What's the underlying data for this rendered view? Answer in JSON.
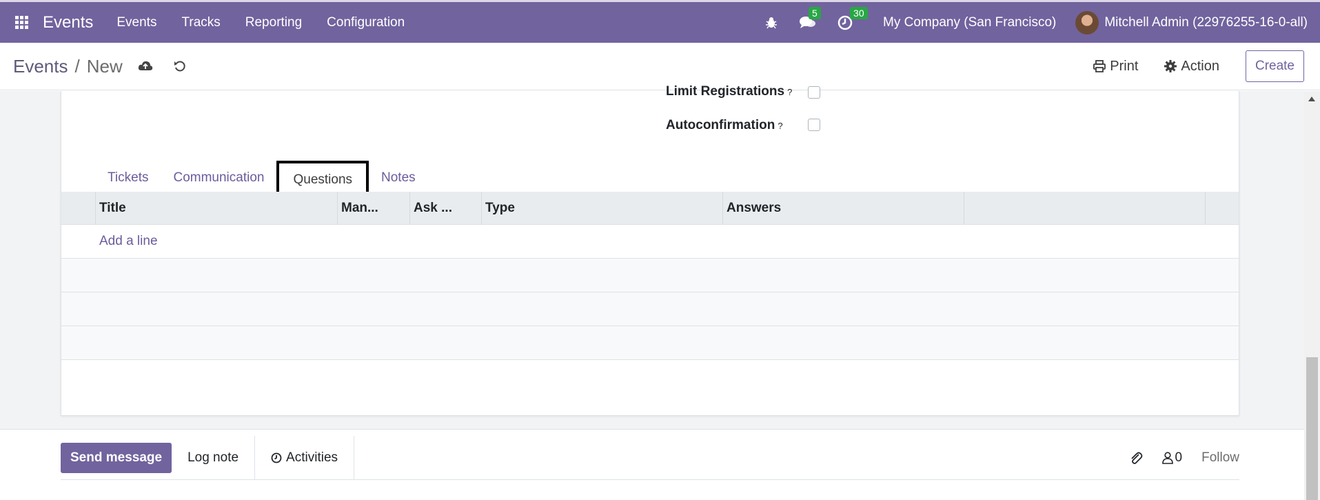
{
  "navbar": {
    "brand": "Events",
    "menu": [
      "Events",
      "Tracks",
      "Reporting",
      "Configuration"
    ],
    "messages_count": "5",
    "activities_count": "30",
    "company": "My Company (San Francisco)",
    "user": "Mitchell Admin (22976255-16-0-all)"
  },
  "control": {
    "breadcrumb_parent": "Events",
    "breadcrumb_sep": "/",
    "breadcrumb_current": "New",
    "print_label": "Print",
    "action_label": "Action",
    "create_label": "Create"
  },
  "form": {
    "limit_registrations_label": "Limit Registrations",
    "limit_registrations_help": "?",
    "autoconfirmation_label": "Autoconfirmation",
    "autoconfirmation_help": "?"
  },
  "tabs": [
    "Tickets",
    "Communication",
    "Questions",
    "Notes"
  ],
  "active_tab": "Questions",
  "table": {
    "columns": [
      "Title",
      "Man...",
      "Ask ...",
      "Type",
      "Answers"
    ],
    "add_line": "Add a line"
  },
  "chatter": {
    "send_message": "Send message",
    "log_note": "Log note",
    "activities": "Activities",
    "followers_count": "0",
    "follow": "Follow"
  },
  "colors": {
    "navbar": "#71639e",
    "accent": "#71639e",
    "badge": "#28a745"
  }
}
